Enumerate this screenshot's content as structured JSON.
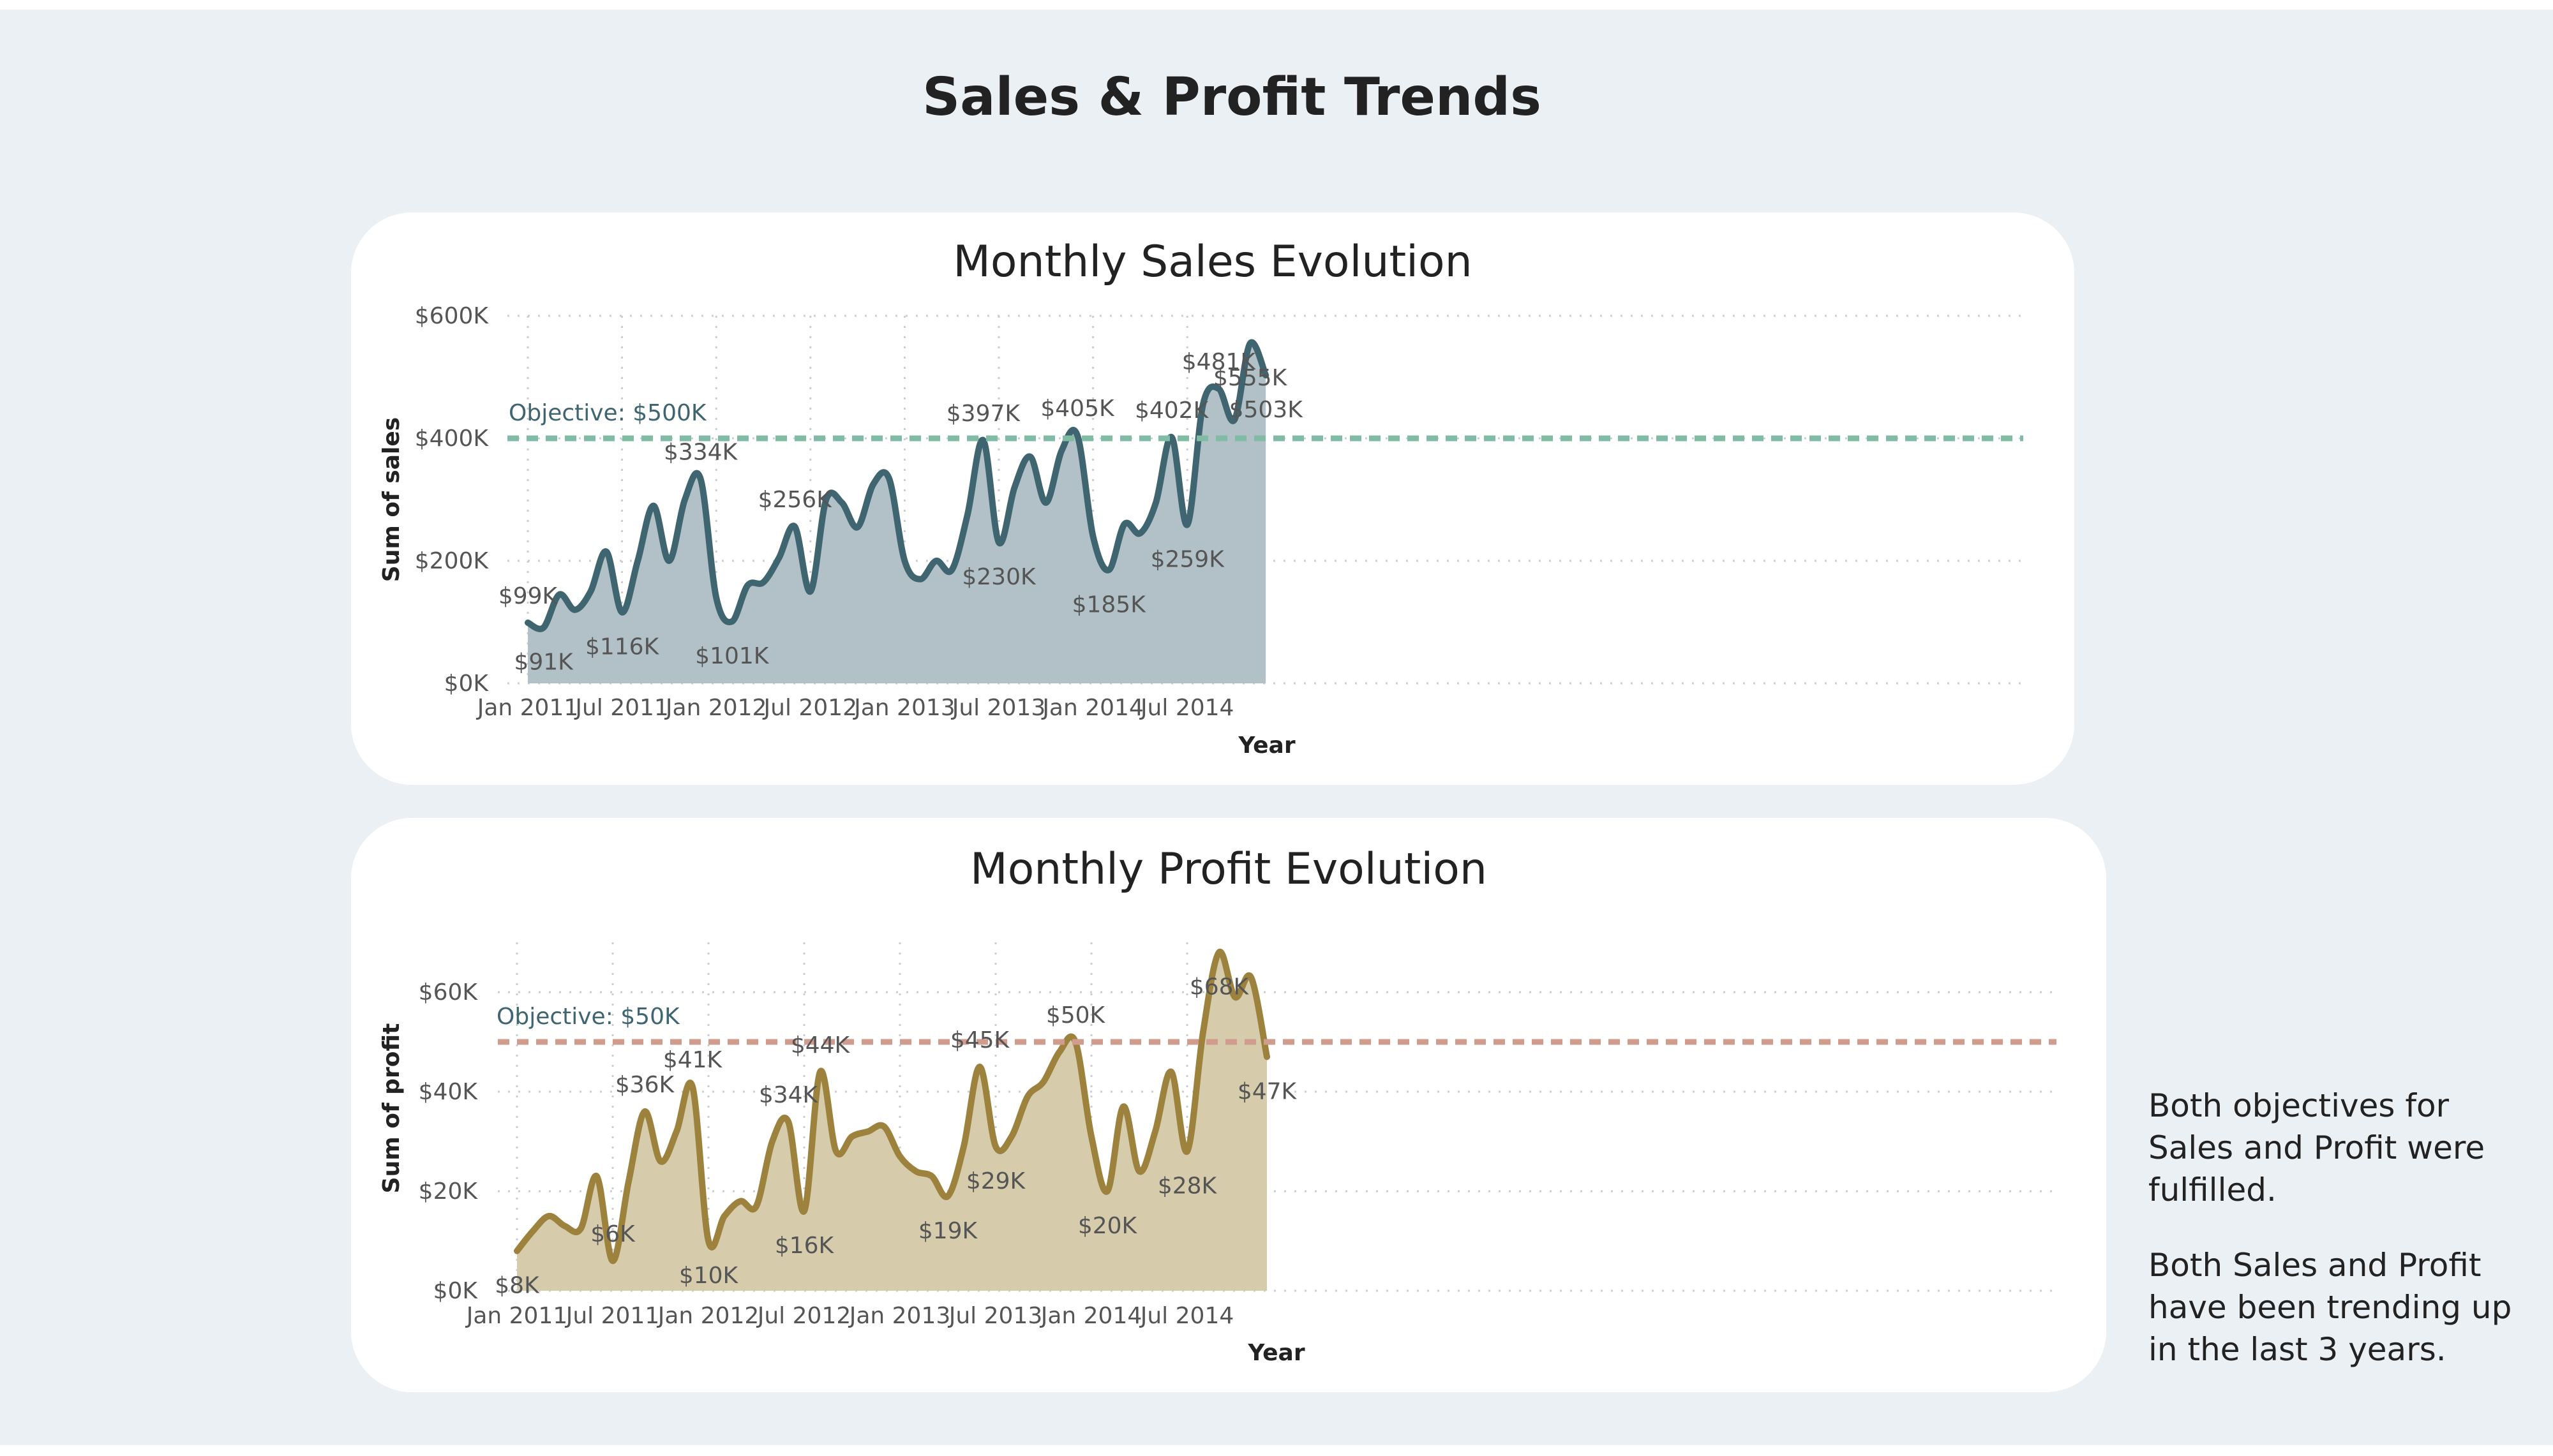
{
  "page": {
    "title": "Sales & Profit Trends",
    "notes": [
      "Both objectives for Sales and Profit were fulfilled.",
      "Both Sales and Profit have been trending up in the last 3 years."
    ]
  },
  "chart_data": [
    {
      "type": "area",
      "title": "Monthly Sales Evolution",
      "xlabel": "Year",
      "ylabel": "Sum of sales",
      "ylim": [
        0,
        600000
      ],
      "yticks": [
        {
          "value": 0,
          "label": "$0K"
        },
        {
          "value": 200000,
          "label": "$200K"
        },
        {
          "value": 400000,
          "label": "$400K"
        },
        {
          "value": 600000,
          "label": "$600K"
        }
      ],
      "xticks": [
        "Jan 2011",
        "Jul 2011",
        "Jan 2012",
        "Jul 2012",
        "Jan 2013",
        "Jul 2013",
        "Jan 2014",
        "Jul 2014"
      ],
      "x_start": "Jan 2011",
      "objective": {
        "value": 400000,
        "label": "Objective: $500K"
      },
      "grid": true,
      "colors": {
        "line": "#3f6570",
        "fill": "#b2c1c7",
        "objective": "#7fbca3",
        "objective_text": "#3f6570"
      },
      "series": [
        {
          "values": [
            99000,
            91000,
            145000,
            120000,
            150000,
            215000,
            116000,
            200000,
            290000,
            200000,
            300000,
            334000,
            140000,
            101000,
            160000,
            165000,
            205000,
            256000,
            150000,
            300000,
            295000,
            255000,
            325000,
            335000,
            200000,
            170000,
            200000,
            185000,
            275000,
            397000,
            230000,
            320000,
            370000,
            295000,
            380000,
            405000,
            240000,
            185000,
            260000,
            245000,
            295000,
            402000,
            259000,
            455000,
            481000,
            430000,
            555000,
            503000
          ]
        }
      ],
      "data_labels": [
        {
          "index": 0,
          "label": "$99K",
          "pos": "above"
        },
        {
          "index": 1,
          "label": "$91K",
          "pos": "below"
        },
        {
          "index": 6,
          "label": "$116K",
          "pos": "below"
        },
        {
          "index": 11,
          "label": "$334K",
          "pos": "above"
        },
        {
          "index": 13,
          "label": "$101K",
          "pos": "below"
        },
        {
          "index": 17,
          "label": "$256K",
          "pos": "above"
        },
        {
          "index": 29,
          "label": "$397K",
          "pos": "above"
        },
        {
          "index": 30,
          "label": "$230K",
          "pos": "below"
        },
        {
          "index": 35,
          "label": "$405K",
          "pos": "above"
        },
        {
          "index": 37,
          "label": "$185K",
          "pos": "below"
        },
        {
          "index": 41,
          "label": "$402K",
          "pos": "above"
        },
        {
          "index": 42,
          "label": "$259K",
          "pos": "below"
        },
        {
          "index": 44,
          "label": "$481K",
          "pos": "above"
        },
        {
          "index": 46,
          "label": "$555K",
          "pos": "below"
        },
        {
          "index": 47,
          "label": "$503K",
          "pos": "below"
        }
      ]
    },
    {
      "type": "area",
      "title": "Monthly Profit Evolution",
      "xlabel": "Year",
      "ylabel": "Sum of profit",
      "ylim": [
        0,
        70000
      ],
      "yticks": [
        {
          "value": 0,
          "label": "$0K"
        },
        {
          "value": 20000,
          "label": "$20K"
        },
        {
          "value": 40000,
          "label": "$40K"
        },
        {
          "value": 60000,
          "label": "$60K"
        }
      ],
      "xticks": [
        "Jan 2011",
        "Jul 2011",
        "Jan 2012",
        "Jul 2012",
        "Jan 2013",
        "Jul 2013",
        "Jan 2014",
        "Jul 2014"
      ],
      "x_start": "Jan 2011",
      "objective": {
        "value": 50000,
        "label": "Objective: $50K"
      },
      "grid": true,
      "colors": {
        "line": "#9c823c",
        "fill": "#d6ccab",
        "objective": "#cf9c8e",
        "objective_text": "#3f6570"
      },
      "series": [
        {
          "values": [
            8000,
            12000,
            15000,
            13000,
            12500,
            23000,
            6000,
            22000,
            36000,
            26000,
            32000,
            41000,
            10000,
            15000,
            18000,
            17000,
            30000,
            34000,
            16000,
            44000,
            28000,
            31000,
            32000,
            33000,
            27000,
            24000,
            23000,
            19000,
            29000,
            45000,
            29000,
            31000,
            39000,
            42000,
            48000,
            50000,
            31000,
            20000,
            37000,
            24000,
            32000,
            44000,
            28000,
            52000,
            68000,
            59000,
            63000,
            47000
          ]
        }
      ],
      "data_labels": [
        {
          "index": 0,
          "label": "$8K",
          "pos": "below"
        },
        {
          "index": 6,
          "label": "$6K",
          "pos": "above"
        },
        {
          "index": 8,
          "label": "$36K",
          "pos": "above"
        },
        {
          "index": 11,
          "label": "$41K",
          "pos": "above"
        },
        {
          "index": 12,
          "label": "$10K",
          "pos": "below"
        },
        {
          "index": 17,
          "label": "$34K",
          "pos": "above"
        },
        {
          "index": 18,
          "label": "$16K",
          "pos": "below"
        },
        {
          "index": 19,
          "label": "$44K",
          "pos": "above"
        },
        {
          "index": 27,
          "label": "$19K",
          "pos": "below"
        },
        {
          "index": 29,
          "label": "$45K",
          "pos": "above"
        },
        {
          "index": 30,
          "label": "$29K",
          "pos": "below"
        },
        {
          "index": 35,
          "label": "$50K",
          "pos": "above"
        },
        {
          "index": 37,
          "label": "$20K",
          "pos": "below"
        },
        {
          "index": 42,
          "label": "$28K",
          "pos": "below"
        },
        {
          "index": 44,
          "label": "$68K",
          "pos": "below"
        },
        {
          "index": 47,
          "label": "$47K",
          "pos": "below"
        }
      ]
    }
  ]
}
